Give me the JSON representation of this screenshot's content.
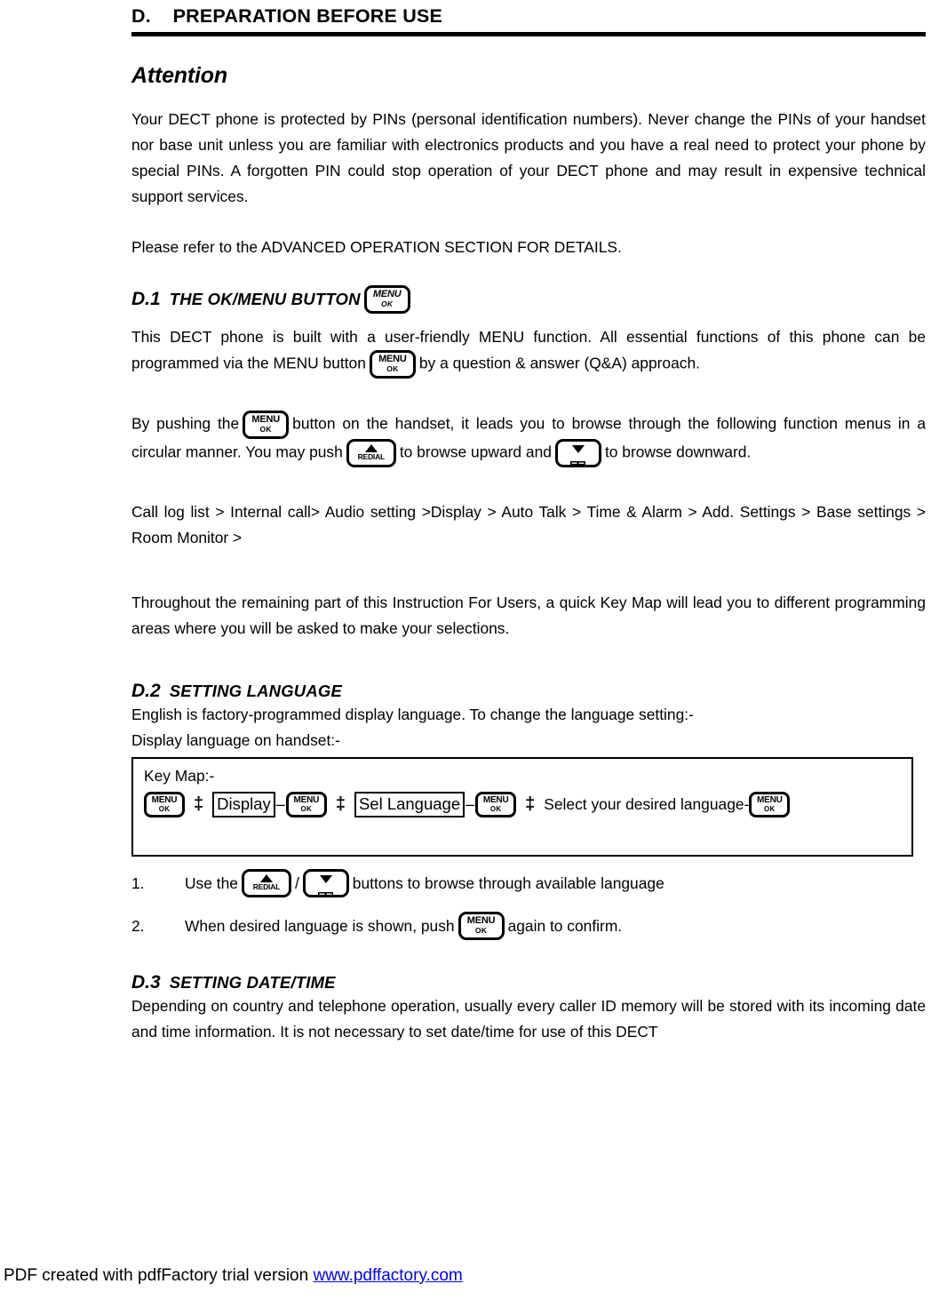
{
  "document": {
    "chapter": {
      "label": "D.",
      "title": "PREPARATION BEFORE USE"
    },
    "attention": {
      "heading": "Attention",
      "paragraph_1": "Your DECT phone is protected by PINs (personal identification numbers). Never change the PINs of your handset nor base unit unless you are familiar with electronics products and you have a real need to protect your phone by special PINs. A forgotten PIN could stop operation of your DECT phone and may result in expensive technical support services.",
      "paragraph_2": "Please refer to the ADVANCED OPERATION SECTION FOR DETAILS."
    },
    "section_d1": {
      "number": "D.1",
      "title": "THE OK/MENU BUTTON",
      "para_1_a": "This DECT phone is built with a user-friendly MENU function. All essential functions of this phone can be programmed via the MENU button",
      "para_1_b": "by a question & answer (Q&A) approach.",
      "para_2_a": "By pushing the",
      "para_2_b": "button on the handset, it leads you to browse through the following function menus in a circular manner. You may push",
      "para_2_c": "to browse upward and",
      "para_2_d": "to browse downward.",
      "menu_chain": "Call log list > Internal call> Audio setting >Display > Auto Talk > Time & Alarm > Add. Settings > Base settings > Room Monitor >",
      "para_3": "Throughout the remaining part of this Instruction For Users, a quick Key Map will lead you to different programming areas where you will be asked to make your selections."
    },
    "section_d2": {
      "number": "D.2",
      "title": "SETTING LANGUAGE",
      "intro_1": "English is factory-programmed display language. To change the language setting:-",
      "intro_2": "Display language on handset:-",
      "keymap": {
        "title": "Key Map:-",
        "arrow": "‡",
        "dash": "–",
        "step_display": "Display",
        "step_sel_language": "Sel Language",
        "step_final_text": "Select your desired language-"
      },
      "steps": [
        {
          "number": "1.",
          "text_a": "Use the",
          "separator": "/",
          "text_b": "buttons to browse through available language"
        },
        {
          "number": "2.",
          "text_a": "When desired language is shown, push",
          "text_b": "again to confirm."
        }
      ]
    },
    "section_d3": {
      "number": "D.3",
      "title": "SETTING DATE/TIME",
      "paragraph": "Depending on country and telephone operation, usually every caller ID memory will be stored with its incoming date and time information. It is not necessary to set date/time for use of this DECT"
    },
    "keys": {
      "menu_line1": "MENU",
      "menu_line2": "OK",
      "redial_label": "REDIAL"
    },
    "footer": {
      "text": "PDF created with pdfFactory trial version",
      "link": "www.pdffactory.com",
      "link_color": "#0000ee"
    }
  }
}
